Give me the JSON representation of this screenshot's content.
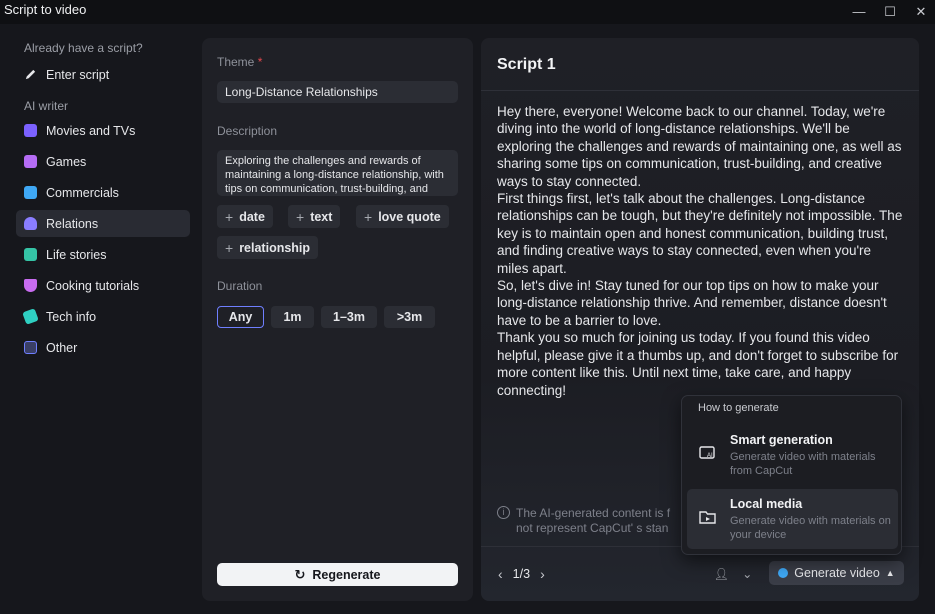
{
  "window": {
    "title": "Script to video",
    "minimize_glyph": "—",
    "maximize_glyph": "☐",
    "close_glyph": "✕"
  },
  "sidebar": {
    "already_label": "Already have a script?",
    "enter_script": "Enter script",
    "ai_writer_label": "AI writer",
    "items": [
      {
        "label": "Movies and TVs",
        "icon": "movies-icon",
        "color": "#7b61ff"
      },
      {
        "label": "Games",
        "icon": "games-icon",
        "color": "#b56cf5"
      },
      {
        "label": "Commercials",
        "icon": "commercials-icon",
        "color": "#3fa8f5"
      },
      {
        "label": "Relations",
        "icon": "relations-icon",
        "color": "#8a7dff"
      },
      {
        "label": "Life stories",
        "icon": "life-stories-icon",
        "color": "#35c4a6"
      },
      {
        "label": "Cooking tutorials",
        "icon": "cooking-icon",
        "color": "#c86cf0"
      },
      {
        "label": "Tech info",
        "icon": "tech-icon",
        "color": "#2fd0c2"
      },
      {
        "label": "Other",
        "icon": "other-icon",
        "color": "#6f7fff"
      }
    ],
    "active_item": "Relations"
  },
  "form": {
    "theme_label": "Theme",
    "required_mark": "*",
    "theme_value": "Long-Distance Relationships",
    "description_label": "Description",
    "description_value": "Exploring the challenges and rewards of maintaining a long-distance relationship, with tips on communication, trust-building, and creative ways to stay connected.",
    "tags": [
      "date",
      "text",
      "love quote",
      "relationship"
    ],
    "tag_prefix": "+",
    "duration_label": "Duration",
    "durations": [
      "Any",
      "1m",
      "1–3m",
      ">3m"
    ],
    "selected_duration": "Any",
    "regenerate_label": "Regenerate"
  },
  "script": {
    "title": "Script 1",
    "paragraphs": [
      "Hey there, everyone! Welcome back to our channel. Today, we're diving into the world of long-distance relationships. We'll be exploring the challenges and rewards of maintaining one, as well as sharing some tips on communication, trust-building, and creative ways to stay connected.",
      "First things first, let's talk about the challenges. Long-distance relationships can be tough, but they're definitely not impossible. The key is to maintain open and honest communication, building trust, and finding creative ways to stay connected, even when you're miles apart.",
      "So, let's dive in! Stay tuned for our top tips on how to make your long-distance relationship thrive. And remember, distance doesn't have to be a barrier to love.",
      "Thank you so much for joining us today. If you found this video helpful, please give it a thumbs up, and don't forget to subscribe for more content like this. Until next time, take care, and happy connecting!"
    ],
    "notice": "The AI-generated content is f not represent CapCut' s stan",
    "page": "1/3",
    "generate_label": "Generate video"
  },
  "popup": {
    "header": "How to generate",
    "options": [
      {
        "title": "Smart generation",
        "desc": "Generate video with materials from CapCut",
        "icon": "ai-generate-icon"
      },
      {
        "title": "Local media",
        "desc": "Generate video with materials on your device",
        "icon": "folder-media-icon"
      }
    ],
    "hovered": "Local media"
  },
  "colors": {
    "accent": "#6f7fff",
    "background": "#16171c",
    "panel": "#1f2026"
  }
}
